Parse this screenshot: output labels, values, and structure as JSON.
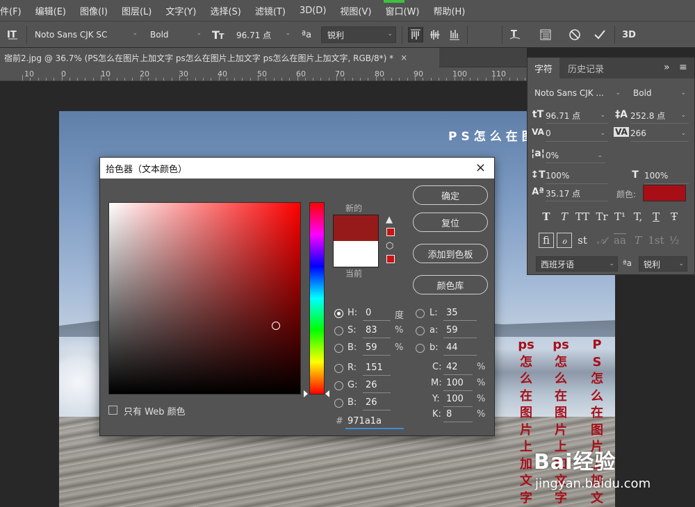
{
  "menu": {
    "items": [
      "件(F)",
      "编辑(E)",
      "图像(I)",
      "图层(L)",
      "文字(Y)",
      "选择(S)",
      "滤镜(T)",
      "3D(D)",
      "视图(V)",
      "窗口(W)",
      "帮助(H)"
    ]
  },
  "options_bar": {
    "tool_icon": "vertical-type-tool-icon",
    "font_family": "Noto Sans CJK SC",
    "font_style": "Bold",
    "font_size": "96.71 点",
    "aa_label": "ªa",
    "antialias": "锐利",
    "text_color": "#a80e16",
    "icons": [
      "align-top-icon",
      "align-center-icon",
      "align-bottom-icon",
      "warp-text-icon",
      "toggle-panels-icon",
      "cancel-icon",
      "commit-icon",
      "3d-icon"
    ]
  },
  "document": {
    "tab_title": "宿前2.jpg @ 36.7% (PS怎么在图片上加文字 ps怎么在图片上加文字 ps怎么在图片上加文字, RGB/8*) *",
    "close": "×",
    "ruler_labels": [
      "10",
      "0",
      "10",
      "20",
      "30",
      "40",
      "50",
      "60",
      "70",
      "80",
      "90",
      "100",
      "110"
    ]
  },
  "canvas": {
    "headline": "PS怎么在图",
    "vertical_texts": [
      "ps怎么在图片上加文字",
      "ps怎么在图片上加文字",
      "PS怎么在图片上加文字"
    ],
    "watermark_brand": "Bai经验",
    "watermark_url": "jingyan.baidu.com"
  },
  "char_panel": {
    "tabs": [
      "字符",
      "历史记录"
    ],
    "collapse": "»",
    "font_family": "Noto Sans CJK ...",
    "font_style": "Bold",
    "size": "96.71 点",
    "leading": "252.8 点",
    "kerning": "0",
    "tracking": "266",
    "tsume": "0%",
    "vscale": "100%",
    "hscale": "100%",
    "baseline": "35.17 点",
    "color_label": "颜色:",
    "color": "#a80e16",
    "language": "西班牙语",
    "aa_label": "ªa",
    "antialias": "锐利",
    "style_buttons": [
      "T",
      "T",
      "TT",
      "Tr",
      "T¹",
      "T,",
      "T",
      "Ŧ"
    ],
    "opentype_buttons": [
      "fi",
      "ℴ",
      "st",
      "𝒜",
      "aa",
      "T",
      "1st",
      "½"
    ]
  },
  "dialog": {
    "title": "拾色器（文本颜色）",
    "close": "×",
    "new_label": "新的",
    "current_label": "当前",
    "new_color": "#971a1a",
    "current_color": "#ffffff",
    "buttons": [
      "确定",
      "复位",
      "添加到色板",
      "颜色库"
    ],
    "web_only_label": "只有 Web 颜色",
    "hsb": [
      {
        "label": "H:",
        "value": "0",
        "unit": "度",
        "selected": true
      },
      {
        "label": "S:",
        "value": "83",
        "unit": "%",
        "selected": false
      },
      {
        "label": "B:",
        "value": "59",
        "unit": "%",
        "selected": false
      }
    ],
    "rgb": [
      {
        "label": "R:",
        "value": "151"
      },
      {
        "label": "G:",
        "value": "26"
      },
      {
        "label": "B:",
        "value": "26"
      }
    ],
    "lab": [
      {
        "label": "L:",
        "value": "35"
      },
      {
        "label": "a:",
        "value": "59"
      },
      {
        "label": "b:",
        "value": "44"
      }
    ],
    "cmyk": [
      {
        "label": "C:",
        "value": "42",
        "unit": "%"
      },
      {
        "label": "M:",
        "value": "100",
        "unit": "%"
      },
      {
        "label": "Y:",
        "value": "100",
        "unit": "%"
      },
      {
        "label": "K:",
        "value": "8",
        "unit": "%"
      }
    ],
    "hex_label": "#",
    "hex": "971a1a"
  }
}
